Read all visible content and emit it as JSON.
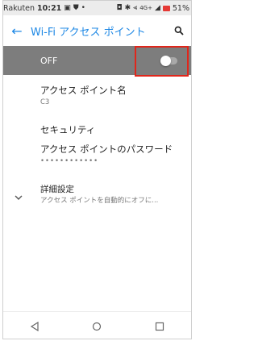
{
  "status_bar": {
    "carrier": "Rakuten",
    "time": "10:21",
    "network": "4G+",
    "battery": "51%"
  },
  "toolbar": {
    "title": "Wi-Fi アクセス ポイント"
  },
  "hotspot_toggle": {
    "label": "OFF",
    "state": "off"
  },
  "settings": [
    {
      "title": "アクセス ポイント名",
      "subtitle": "C3"
    },
    {
      "title": "セキュリティ",
      "subtitle": ""
    },
    {
      "title": "アクセス ポイントのパスワード",
      "subtitle": "••••••••••••"
    },
    {
      "title": "詳細設定",
      "subtitle": "アクセス ポイントを自動的にオフに..."
    }
  ],
  "colors": {
    "accent": "#1e88e5",
    "toggle_bar": "#7d7d7d",
    "highlight": "#e0261b"
  }
}
